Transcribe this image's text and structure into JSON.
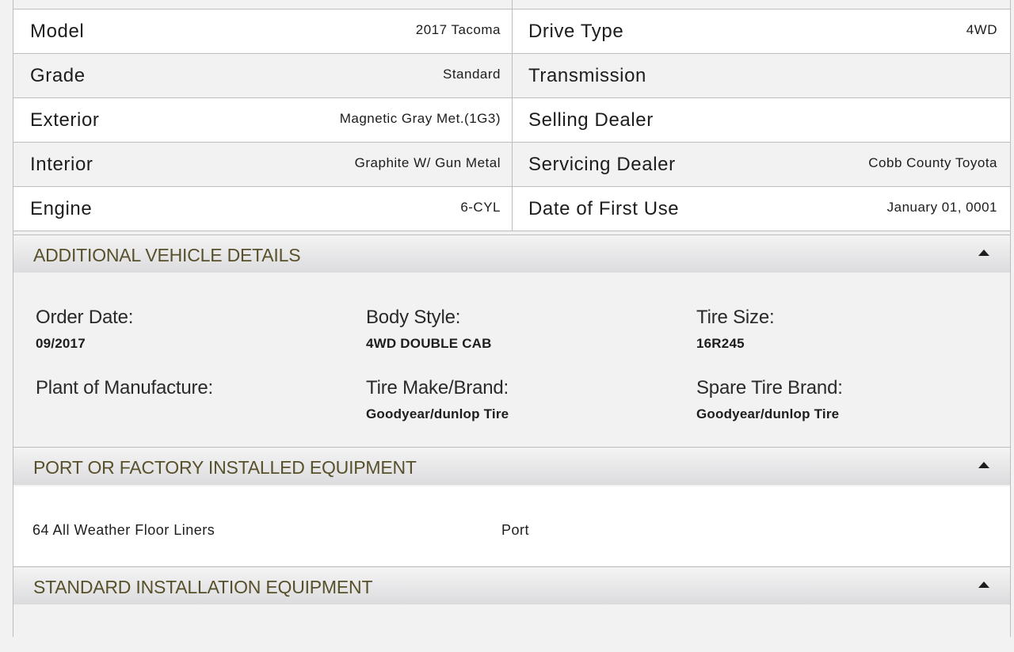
{
  "specs": {
    "left": [
      {
        "label": "Model",
        "value": "2017 Tacoma"
      },
      {
        "label": "Grade",
        "value": "Standard"
      },
      {
        "label": "Exterior",
        "value": "Magnetic Gray Met.(1G3)"
      },
      {
        "label": "Interior",
        "value": "Graphite W/ Gun Metal"
      },
      {
        "label": "Engine",
        "value": "6-CYL"
      }
    ],
    "right": [
      {
        "label": "Drive Type",
        "value": "4WD"
      },
      {
        "label": "Transmission",
        "value": ""
      },
      {
        "label": "Selling Dealer",
        "value": ""
      },
      {
        "label": "Servicing Dealer",
        "value": "Cobb County Toyota"
      },
      {
        "label": "Date of First Use",
        "value": "January 01, 0001"
      }
    ]
  },
  "additional": {
    "title": "ADDITIONAL VEHICLE DETAILS",
    "items": [
      {
        "label": "Order Date:",
        "value": "09/2017"
      },
      {
        "label": "Body Style:",
        "value": "4WD DOUBLE CAB"
      },
      {
        "label": "Tire Size:",
        "value": "16R245"
      },
      {
        "label": "Plant of Manufacture:",
        "value": ""
      },
      {
        "label": "Tire Make/Brand:",
        "value": "Goodyear/dunlop Tire"
      },
      {
        "label": "Spare Tire Brand:",
        "value": "Goodyear/dunlop Tire"
      }
    ]
  },
  "port_equipment": {
    "title": "PORT OR FACTORY INSTALLED EQUIPMENT",
    "items": [
      {
        "name": "64 All Weather Floor Liners",
        "type": "Port"
      }
    ]
  },
  "standard_equipment": {
    "title": "STANDARD INSTALLATION EQUIPMENT"
  },
  "icons": {
    "collapse": "caret-up-icon"
  },
  "colors": {
    "header_text": "#57502b",
    "border": "#bdbdbd"
  }
}
